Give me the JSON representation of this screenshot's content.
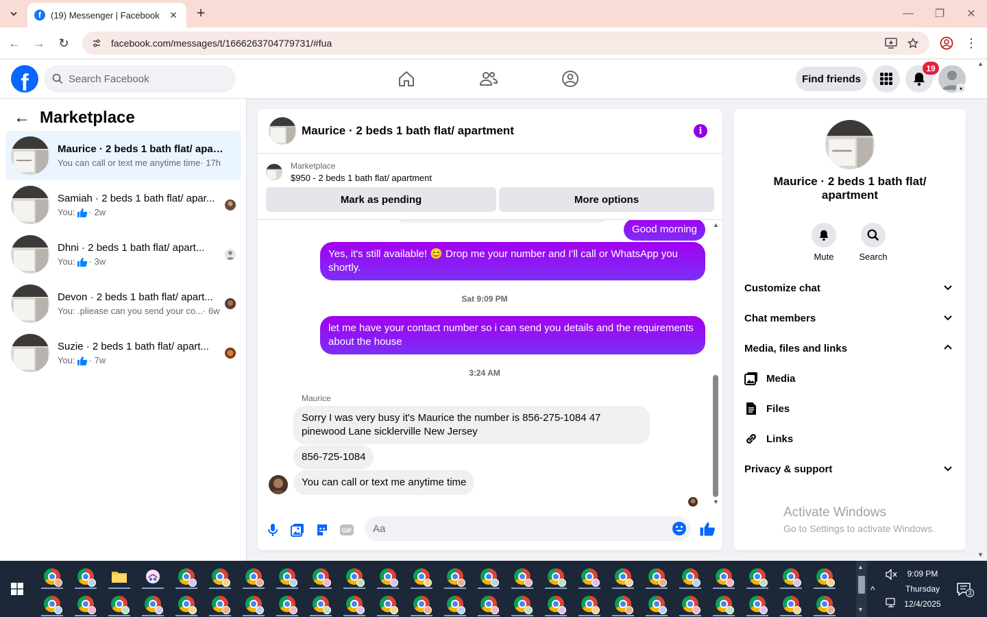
{
  "browser": {
    "tab_title": "(19) Messenger | Facebook",
    "url": "facebook.com/messages/t/1666263704779731/#fua"
  },
  "header": {
    "search_placeholder": "Search Facebook",
    "find_friends": "Find friends",
    "notification_count": "19"
  },
  "sidebar": {
    "title": "Marketplace",
    "conversations": [
      {
        "name": "Maurice · 2 beds 1 bath flat/ apart...",
        "preview": "You can call or text me anytime time",
        "time": "· 17h",
        "active": true
      },
      {
        "name": "Samiah · 2 beds 1 bath flat/ apar...",
        "preview": "You:",
        "time": "· 2w"
      },
      {
        "name": "Dhni · 2 beds 1 bath flat/ apart...",
        "preview": "You:",
        "time": "· 3w"
      },
      {
        "name": "Devon · 2 beds 1 bath flat/ apart...",
        "preview": "You: .pliease can you send your co...",
        "time": "· 6w"
      },
      {
        "name": "Suzie · 2 beds 1 bath flat/ apart...",
        "preview": "You:",
        "time": "· 7w"
      }
    ]
  },
  "chat": {
    "title": "Maurice · 2 beds 1 bath flat/ apartment",
    "listing_label": "Marketplace",
    "listing_price": "$950 - 2 beds 1 bath flat/ apartment",
    "mark_pending": "Mark as pending",
    "more_options": "More options",
    "messages": {
      "m1": "Good morning",
      "m2": "Yes, it's still available! 😊 Drop me your number and I'll call or WhatsApp you shortly.",
      "ts1": "Sat 9:09 PM",
      "m3": "let me have your contact number so i can send you details and the requirements about the house",
      "ts2": "3:24 AM",
      "sender": "Maurice",
      "m4": "Sorry I was very busy it's Maurice the number is 856-275-1084  47 pinewood Lane sicklerville New Jersey",
      "m5": "856-725-1084",
      "m6": "You can call or text me anytime time"
    },
    "composer_placeholder": "Aa"
  },
  "right_panel": {
    "name": "Maurice · 2 beds 1 bath flat/ apartment",
    "mute": "Mute",
    "search": "Search",
    "customize": "Customize chat",
    "members": "Chat members",
    "media_files": "Media, files and links",
    "media": "Media",
    "files": "Files",
    "links": "Links",
    "privacy": "Privacy & support"
  },
  "watermark": {
    "line1": "Activate Windows",
    "line2": "Go to Settings to activate Windows."
  },
  "taskbar": {
    "time": "9:09 PM",
    "day": "Thursday",
    "date": "12/4/2025",
    "notif_count": "3"
  },
  "colors": {
    "fb_blue": "#0866ff",
    "bubble_purple": "#9b00ea",
    "badge_red": "#e41e3f"
  }
}
